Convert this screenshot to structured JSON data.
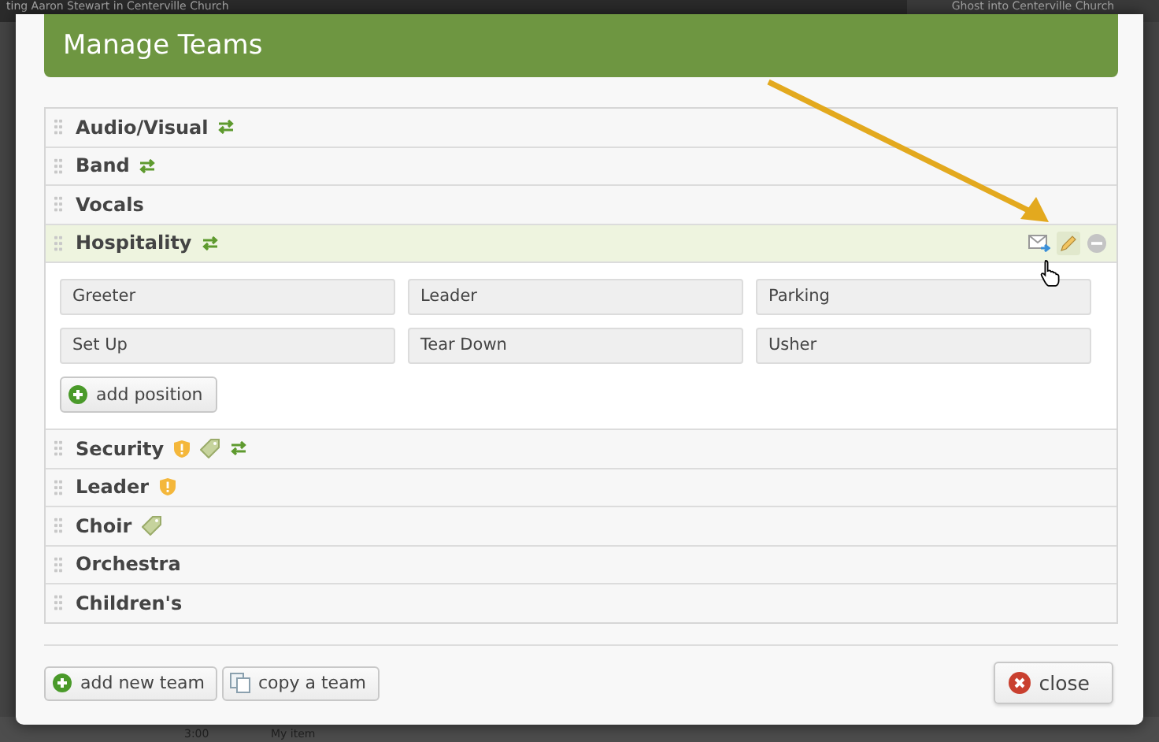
{
  "background": {
    "top_left": "ting Aaron Stewart in Centerville Church",
    "top_right": "Ghost into Centerville Church",
    "bottom_time": "3:00",
    "bottom_item": "My item"
  },
  "dialog": {
    "title": "Manage Teams"
  },
  "teams": [
    {
      "name": "Audio/Visual",
      "badges": [
        {
          "kind": "swap"
        }
      ],
      "selected": false,
      "expanded": false
    },
    {
      "name": "Band",
      "badges": [
        {
          "kind": "swap"
        }
      ],
      "selected": false,
      "expanded": false
    },
    {
      "name": "Vocals",
      "selected": false,
      "expanded": false
    },
    {
      "name": "Hospitality",
      "badges": [
        {
          "kind": "swap"
        }
      ],
      "selected": true,
      "expanded": true,
      "positions": [
        "Greeter",
        "Leader",
        "Parking",
        "Set Up",
        "Tear Down",
        "Usher"
      ],
      "add_position": "add position"
    },
    {
      "name": "Security",
      "badges": [
        {
          "kind": "shield"
        },
        {
          "kind": "tag"
        },
        {
          "kind": "swap"
        }
      ],
      "selected": false,
      "expanded": false
    },
    {
      "name": "Leader",
      "badges": [
        {
          "kind": "shield"
        }
      ],
      "selected": false,
      "expanded": false
    },
    {
      "name": "Choir",
      "badges": [
        {
          "kind": "tag"
        }
      ],
      "selected": false,
      "expanded": false
    },
    {
      "name": "Orchestra",
      "selected": false,
      "expanded": false
    },
    {
      "name": "Children's",
      "selected": false,
      "expanded": false
    }
  ],
  "footer": {
    "add_team": "add new team",
    "copy_team": "copy a team",
    "close": "close"
  }
}
